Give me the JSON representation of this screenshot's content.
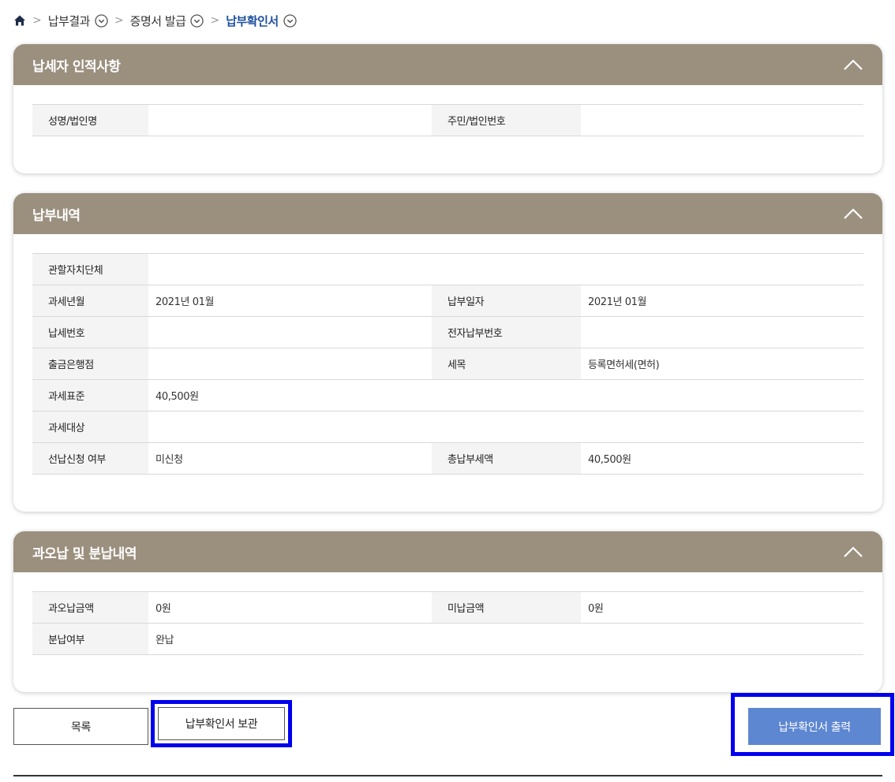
{
  "breadcrumb": {
    "items": [
      {
        "label": "납부결과"
      },
      {
        "label": "증명서 발급"
      },
      {
        "label": "납부확인서"
      }
    ]
  },
  "panels": {
    "taxpayer": {
      "title": "납세자 인적사항",
      "rows": [
        {
          "label1": "성명/법인명",
          "value1": "",
          "label2": "주민/법인번호",
          "value2": ""
        }
      ]
    },
    "payment": {
      "title": "납부내역",
      "authority": {
        "label": "관할자치단체",
        "value": ""
      },
      "tax_year": {
        "label": "과세년월",
        "value": "2021년 01월"
      },
      "pay_date": {
        "label": "납부일자",
        "value": "2021년 01월"
      },
      "tax_no": {
        "label": "납세번호",
        "value": ""
      },
      "epay_no": {
        "label": "전자납부번호",
        "value": ""
      },
      "bank": {
        "label": "출금은행점",
        "value": ""
      },
      "tax_item": {
        "label": "세목",
        "value": "등록면허세(면허)"
      },
      "tax_base": {
        "label": "과세표준",
        "value": "40,500원"
      },
      "tax_target": {
        "label": "과세대상",
        "value": ""
      },
      "prepay": {
        "label": "선납신청 여부",
        "value": "미신청"
      },
      "total": {
        "label": "총납부세액",
        "value": "40,500원"
      }
    },
    "installment": {
      "title": "과오납 및 분납내역",
      "overpaid": {
        "label": "과오납금액",
        "value": "0원"
      },
      "unpaid": {
        "label": "미납금액",
        "value": "0원"
      },
      "installment_status": {
        "label": "분납여부",
        "value": "완납"
      }
    }
  },
  "buttons": {
    "list": "목록",
    "save": "납부확인서 보관",
    "print": "납부확인서 출력"
  },
  "colors": {
    "header": "#9b8f7e",
    "accent": "#1d4fa0",
    "print_button": "#5e87d1",
    "highlight": "#0000ee"
  }
}
